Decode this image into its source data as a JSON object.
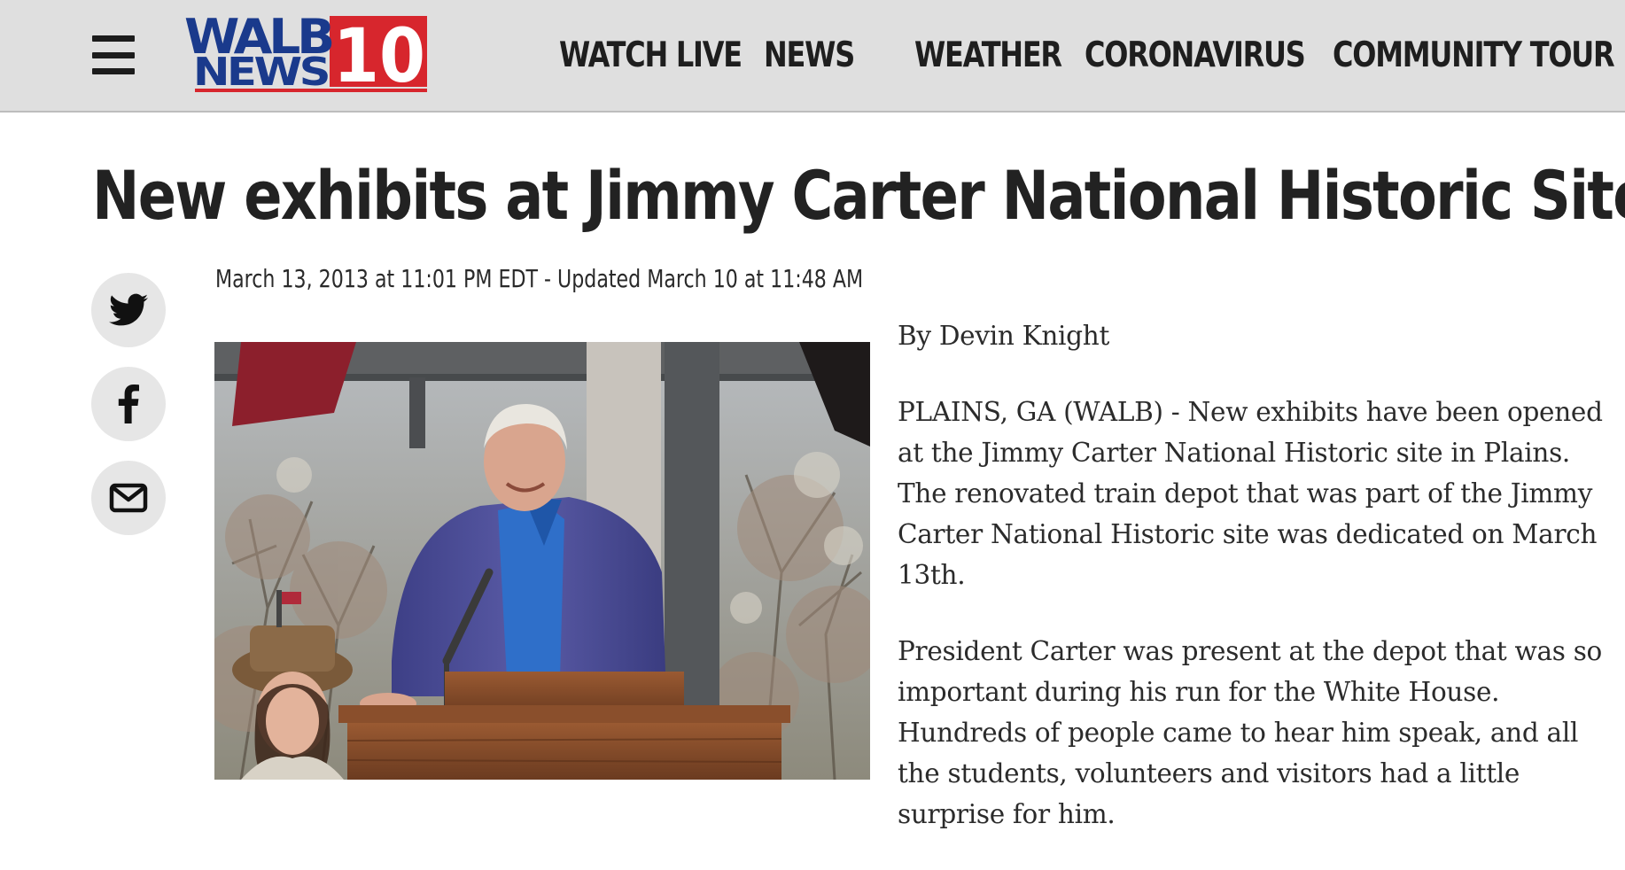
{
  "header": {
    "logo": {
      "line1": "WALB",
      "line2": "NEWS",
      "number": "10",
      "brand_red": "#d7262d",
      "brand_blue": "#1a3a8c"
    },
    "nav": [
      "WATCH LIVE",
      "NEWS",
      "WEATHER",
      "CORONAVIRUS",
      "COMMUNITY TOUR"
    ]
  },
  "article": {
    "title": "New exhibits at Jimmy Carter National Historic Site",
    "timestamp": "March 13, 2013 at 11:01 PM EDT - Updated March 10 at 11:48 AM",
    "byline": "By Devin Knight",
    "paragraphs": [
      "PLAINS, GA (WALB) - New exhibits have been opened at the Jimmy Carter National Historic site in Plains. The renovated train depot that was part of the Jimmy Carter National Historic site was dedicated on March 13th.",
      "President Carter was present at the depot that was so important during his run for the White House. Hundreds of people came to hear him speak, and all the students, volunteers and visitors had a little surprise for him."
    ]
  },
  "share": [
    "twitter-icon",
    "facebook-icon",
    "email-icon"
  ],
  "icons": {
    "menu": "hamburger-icon"
  }
}
